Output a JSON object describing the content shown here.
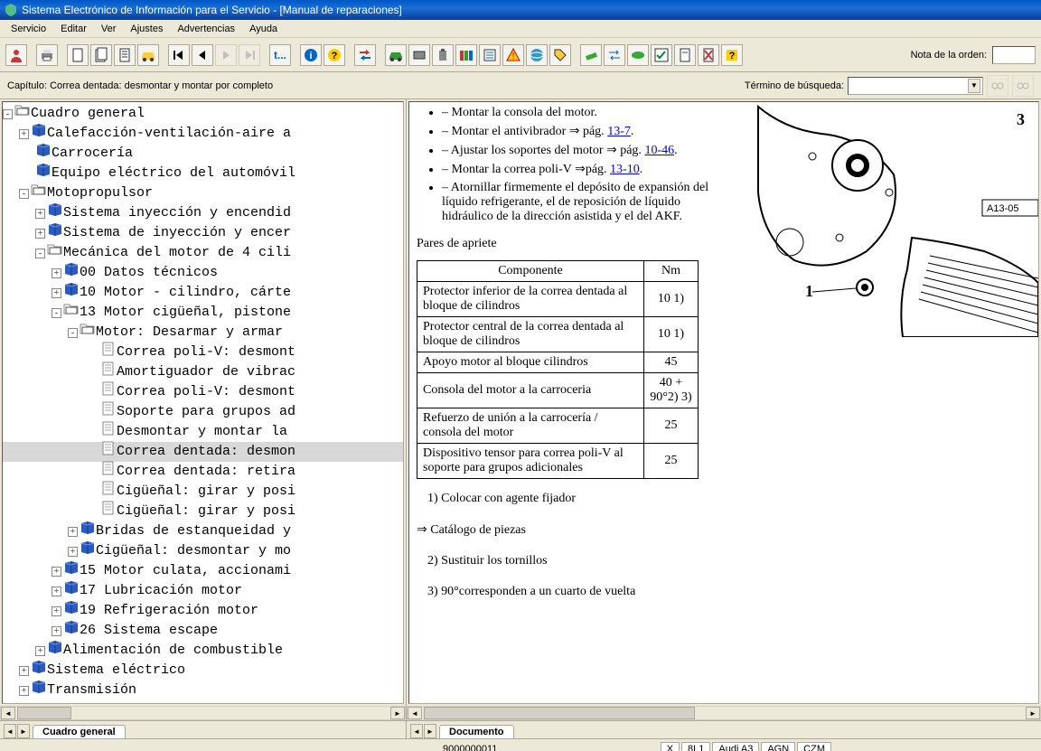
{
  "title": "Sistema Electrónico de Información para el Servicio - [Manual de reparaciones]",
  "menu": [
    "Servicio",
    "Editar",
    "Ver",
    "Ajustes",
    "Advertencias",
    "Ayuda"
  ],
  "toolbar": {
    "order_label": "Nota de la orden:"
  },
  "chapter_label": "Capítulo: Correa dentada: desmontar y montar por completo",
  "search_label": "Término de búsqueda:",
  "tree": [
    {
      "d": 0,
      "tw": "-",
      "ico": "open",
      "t": "Cuadro general"
    },
    {
      "d": 1,
      "tw": "+",
      "ico": "closed",
      "t": "Calefacción-ventilación-aire a"
    },
    {
      "d": 1,
      "tw": "",
      "ico": "closed",
      "t": "Carrocería"
    },
    {
      "d": 1,
      "tw": "",
      "ico": "closed",
      "t": "Equipo eléctrico del automóvil"
    },
    {
      "d": 1,
      "tw": "-",
      "ico": "open",
      "t": "Motopropulsor"
    },
    {
      "d": 2,
      "tw": "+",
      "ico": "closed",
      "t": "Sistema inyección y encendid"
    },
    {
      "d": 2,
      "tw": "+",
      "ico": "closed",
      "t": "Sistema de inyección y encer"
    },
    {
      "d": 2,
      "tw": "-",
      "ico": "open",
      "t": "Mecánica del motor de 4 cili"
    },
    {
      "d": 3,
      "tw": "+",
      "ico": "closed",
      "t": "00 Datos técnicos"
    },
    {
      "d": 3,
      "tw": "+",
      "ico": "closed",
      "t": "10 Motor - cilindro, cárte"
    },
    {
      "d": 3,
      "tw": "-",
      "ico": "open",
      "t": "13 Motor cigüeñal, pistone"
    },
    {
      "d": 4,
      "tw": "-",
      "ico": "open",
      "t": "Motor: Desarmar y armar"
    },
    {
      "d": 5,
      "tw": "",
      "ico": "page",
      "t": "Correa poli-V: desmont"
    },
    {
      "d": 5,
      "tw": "",
      "ico": "page",
      "t": "Amortiguador de vibrac"
    },
    {
      "d": 5,
      "tw": "",
      "ico": "page",
      "t": "Correa poli-V: desmont"
    },
    {
      "d": 5,
      "tw": "",
      "ico": "page",
      "t": "Soporte para grupos ad"
    },
    {
      "d": 5,
      "tw": "",
      "ico": "page",
      "t": "Desmontar y montar la"
    },
    {
      "d": 5,
      "tw": "",
      "ico": "page",
      "t": "Correa dentada: desmon",
      "sel": true
    },
    {
      "d": 5,
      "tw": "",
      "ico": "page",
      "t": "Correa dentada: retira"
    },
    {
      "d": 5,
      "tw": "",
      "ico": "page",
      "t": "Cigüeñal: girar y posi"
    },
    {
      "d": 5,
      "tw": "",
      "ico": "page",
      "t": "Cigüeñal: girar y posi"
    },
    {
      "d": 4,
      "tw": "+",
      "ico": "closed",
      "t": "Bridas de estanqueidad y"
    },
    {
      "d": 4,
      "tw": "+",
      "ico": "closed",
      "t": "Cigüeñal: desmontar y mo"
    },
    {
      "d": 3,
      "tw": "+",
      "ico": "closed",
      "t": "15 Motor culata, accionami"
    },
    {
      "d": 3,
      "tw": "+",
      "ico": "closed",
      "t": "17 Lubricación motor"
    },
    {
      "d": 3,
      "tw": "+",
      "ico": "closed",
      "t": "19 Refrigeración motor"
    },
    {
      "d": 3,
      "tw": "+",
      "ico": "closed",
      "t": "26 Sistema escape"
    },
    {
      "d": 2,
      "tw": "+",
      "ico": "closed",
      "t": "Alimentación de combustible"
    },
    {
      "d": 1,
      "tw": "+",
      "ico": "closed",
      "t": "Sistema eléctrico"
    },
    {
      "d": 1,
      "tw": "+",
      "ico": "closed",
      "t": "Transmisión"
    }
  ],
  "left_tab": "Cuadro general",
  "right_tab": "Documento",
  "doc": {
    "bullets": [
      {
        "text": "– Montar la consola del motor."
      },
      {
        "text": "– Montar el antivibrador ⇒ pág. ",
        "link": "13-7",
        "suffix": "."
      },
      {
        "text": "– Ajustar los soportes del motor ⇒ pág. ",
        "link": "10-46",
        "suffix": "."
      },
      {
        "text": "– Montar la correa poli-V ⇒pág. ",
        "link": "13-10",
        "suffix": "."
      },
      {
        "text": "– Atornillar firmemente el depósito de expansión del líquido refrigerante, el de reposición de líquido hidráulico de la dirección asistida y el del AKF."
      }
    ],
    "section": "Pares de apriete",
    "th1": "Componente",
    "th2": "Nm",
    "rows": [
      {
        "c": "Protector inferior de la correa dentada al bloque de cilindros",
        "n": "10 1)"
      },
      {
        "c": "Protector central de la correa dentada al bloque de cilindros",
        "n": "10 1)"
      },
      {
        "c": "Apoyo motor al bloque cilindros",
        "n": "45"
      },
      {
        "c": "Consola del motor a la carroceria",
        "n": "40 + 90°2) 3)"
      },
      {
        "c": "Refuerzo de unión a la carrocería / consola del motor",
        "n": "25"
      },
      {
        "c": "Dispositivo tensor para correa poli-V al soporte para grupos adicionales",
        "n": "25"
      }
    ],
    "note1": "1)   Colocar con agente fijador",
    "catalog": "⇒ Catálogo de piezas",
    "note2": "2)   Sustituir los tornillos",
    "note3": "3)   90°corresponden a un cuarto de vuelta"
  },
  "diagram": {
    "label1": "1",
    "label3": "3",
    "code": "A13-05"
  },
  "status": {
    "num": "9000000011",
    "c1": "X",
    "c2": "8L1",
    "c3": "Audi A3",
    "c4": "AGN",
    "c5": "CZM"
  }
}
